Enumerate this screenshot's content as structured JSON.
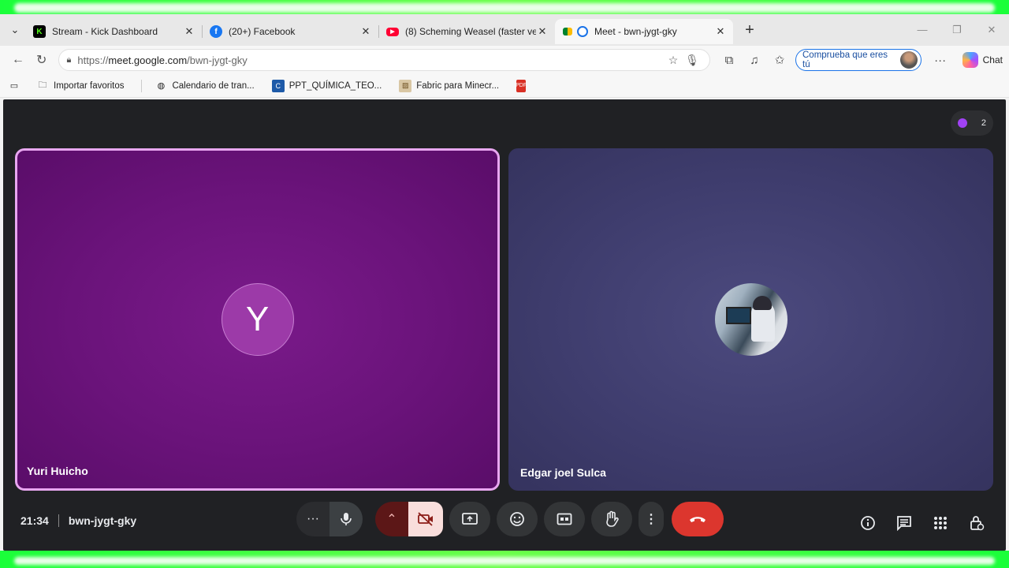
{
  "browser": {
    "tabs": [
      {
        "title": "Stream - Kick Dashboard",
        "favicon": "kick-icon",
        "color": "#53fc18"
      },
      {
        "title": "(20+) Facebook",
        "favicon": "facebook-icon",
        "color": "#1877f2"
      },
      {
        "title": "(8) Scheming Weasel (faster versio",
        "favicon": "youtube-icon",
        "color": "#ff0033"
      },
      {
        "title": "Meet - bwn-jygt-gky",
        "favicon": "meet-icon",
        "color": "#00832d",
        "active": true
      }
    ],
    "url_prefix": "https://",
    "url_host": "meet.google.com",
    "url_path": "/bwn-jygt-gky",
    "profile_label": "Comprueba que eres tú",
    "chat_label": "Chat",
    "bookmarks": [
      {
        "label": "Importar favoritos",
        "icon": "folder-import-icon"
      },
      {
        "label": "Calendario de tran...",
        "icon": "globe-icon"
      },
      {
        "label": "PPT_QUÍMICA_TEO...",
        "icon": "canva-icon"
      },
      {
        "label": "Fabric para Minecr...",
        "icon": "fabric-icon"
      },
      {
        "label": "",
        "icon": "pdf-icon"
      }
    ]
  },
  "meet": {
    "participant_count": "2",
    "tiles": [
      {
        "name": "Yuri Huicho",
        "initial": "Y",
        "bg": "#6a137a",
        "speaking": true
      },
      {
        "name": "Edgar joel Sulca",
        "initial": "",
        "bg": "#3f3d6e",
        "speaking": false
      }
    ],
    "time": "21:34",
    "meeting_code": "bwn-jygt-gky",
    "colors": {
      "end_call": "#dc362e",
      "camera_off": "#f9dedc",
      "speaking_border": "#e8a6f0"
    }
  }
}
